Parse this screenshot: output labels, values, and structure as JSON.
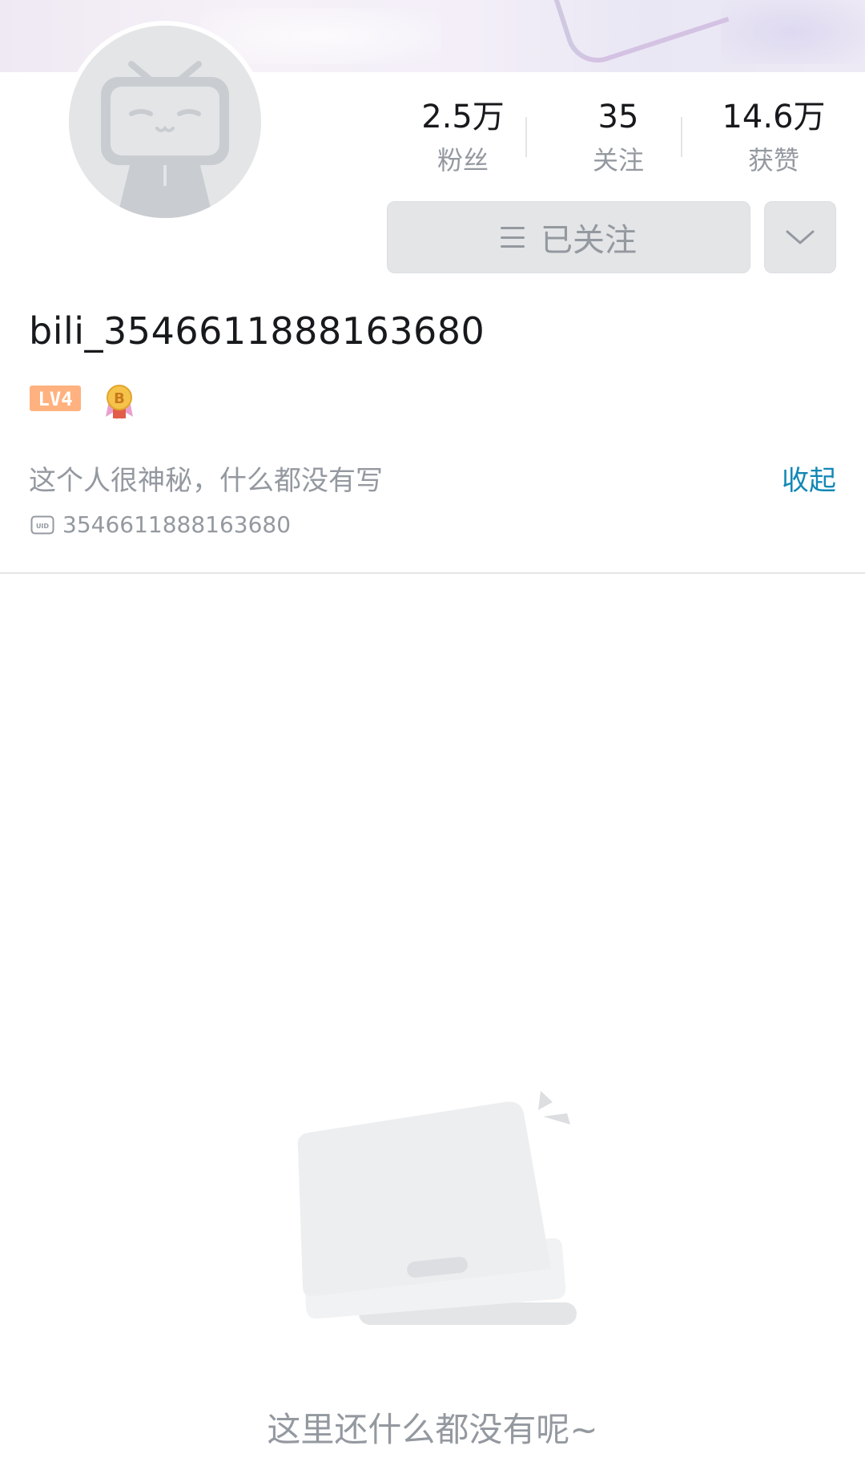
{
  "profile": {
    "username": "bili_3546611888163680",
    "level": "LV4",
    "sign": "这个人很神秘，什么都没有写",
    "collapse_label": "收起",
    "uid": "3546611888163680"
  },
  "stats": [
    {
      "value": "2.5万",
      "label": "粉丝"
    },
    {
      "value": "35",
      "label": "关注"
    },
    {
      "value": "14.6万",
      "label": "获赞"
    }
  ],
  "actions": {
    "follow_label": "已关注"
  },
  "empty": {
    "message": "这里还什么都没有呢~"
  },
  "colors": {
    "accent_link": "#1288b5",
    "level_badge": "#ffb27f",
    "secondary_text": "#9499a0"
  }
}
